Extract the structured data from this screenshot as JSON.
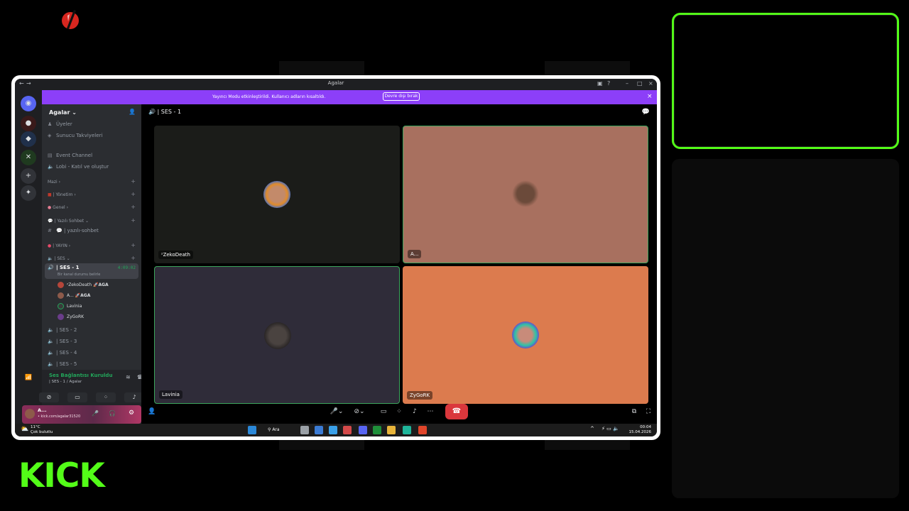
{
  "overlay": {
    "brand": "KICK",
    "colors": {
      "accent": "#53fc18",
      "banner": "#8c3ff8",
      "hangup": "#da373c"
    }
  },
  "window": {
    "title": "Agalar",
    "controls": [
      "minimize-icon",
      "maximize-icon",
      "close-icon"
    ]
  },
  "banner": {
    "text": "Yayıncı Modu etkinleştirildi. Kullanıcı adların kısaltıldı.",
    "button": "Devre dışı bırak"
  },
  "sidebar": {
    "server_name": "Agalar",
    "top_items": [
      "Üyeler",
      "Sunucu Takviyeleri"
    ],
    "channels_a": [
      "Event Channel",
      "Lobi - Katıl ve oluştur"
    ],
    "categories": {
      "mazi": "Mazi",
      "yonetim": "| Yönetim",
      "genel": "Genel",
      "yazili": "| Yazılı Sohbet",
      "yayin": "| YAYIN",
      "ses": "| SES"
    },
    "text_channel": "| yazılı-sohbet",
    "active_voice": {
      "name": "| SES - 1",
      "status": "Bir kanal durumu belirle",
      "timer": "4:09:02"
    },
    "voice_users": [
      {
        "name": "ᶻZekoDeath",
        "tag": "AGA"
      },
      {
        "name": "A...",
        "tag": "AGA"
      },
      {
        "name": "Lavinia",
        "tag": ""
      },
      {
        "name": "ZyGoRK",
        "tag": ""
      }
    ],
    "other_voice": [
      "| SES - 2",
      "| SES - 3",
      "| SES - 4",
      "| SES - 5"
    ]
  },
  "voice_panel": {
    "status": "Ses Bağlantısı Kuruldu",
    "channel": "| SES - 1 / Agalar"
  },
  "user_panel": {
    "name": "A...",
    "sub": "• kick.com/agalar31520"
  },
  "main": {
    "header": "| SES - 1",
    "tiles": [
      {
        "name": "ᶻZekoDeath",
        "bg": "#1b1c19"
      },
      {
        "name": "A...",
        "bg": "#a8705f"
      },
      {
        "name": "Lavinia",
        "bg": "#2f2c39"
      },
      {
        "name": "ZyGoRK",
        "bg": "#dc7b4e"
      }
    ]
  },
  "taskbar": {
    "weather_temp": "11°C",
    "weather_desc": "Çok bulutlu",
    "search": "Ara",
    "time": "00:04",
    "date": "15.04.2026"
  }
}
